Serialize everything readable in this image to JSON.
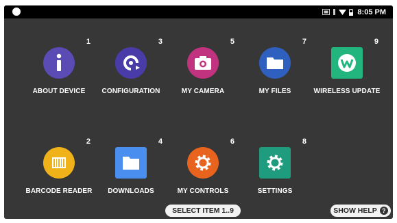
{
  "status_bar": {
    "time": "8:05 PM",
    "icons": [
      "circle-icon",
      "screenshot-icon",
      "vibrate-icon",
      "wifi-icon",
      "battery-icon"
    ]
  },
  "tiles": [
    {
      "number": "1",
      "label": "ABOUT DEVICE",
      "icon": "info-icon",
      "color": "#5a4bb5"
    },
    {
      "number": "3",
      "label": "CONFIGURATION",
      "icon": "sync-icon",
      "color": "#4a3ca8"
    },
    {
      "number": "5",
      "label": "MY CAMERA",
      "icon": "camera-icon",
      "color": "#c2337f"
    },
    {
      "number": "7",
      "label": "MY FILES",
      "icon": "folder-icon",
      "color": "#2f5fbf"
    },
    {
      "number": "9",
      "label": "WIRELESS UPDATE",
      "icon": "wireless-update-icon",
      "color": "#22b57e"
    },
    {
      "number": "2",
      "label": "BARCODE READER",
      "icon": "barcode-icon",
      "color": "#f0b219"
    },
    {
      "number": "4",
      "label": "DOWNLOADS",
      "icon": "folder-icon",
      "color": "#4a8ef0"
    },
    {
      "number": "6",
      "label": "MY CONTROLS",
      "icon": "gear-icon",
      "color": "#e8641e"
    },
    {
      "number": "8",
      "label": "SETTINGS",
      "icon": "gear-icon",
      "color": "#1f9b7e"
    }
  ],
  "footer": {
    "select_label": "SELECT ITEM 1..9",
    "help_label": "SHOW HELP",
    "help_icon": "?"
  }
}
